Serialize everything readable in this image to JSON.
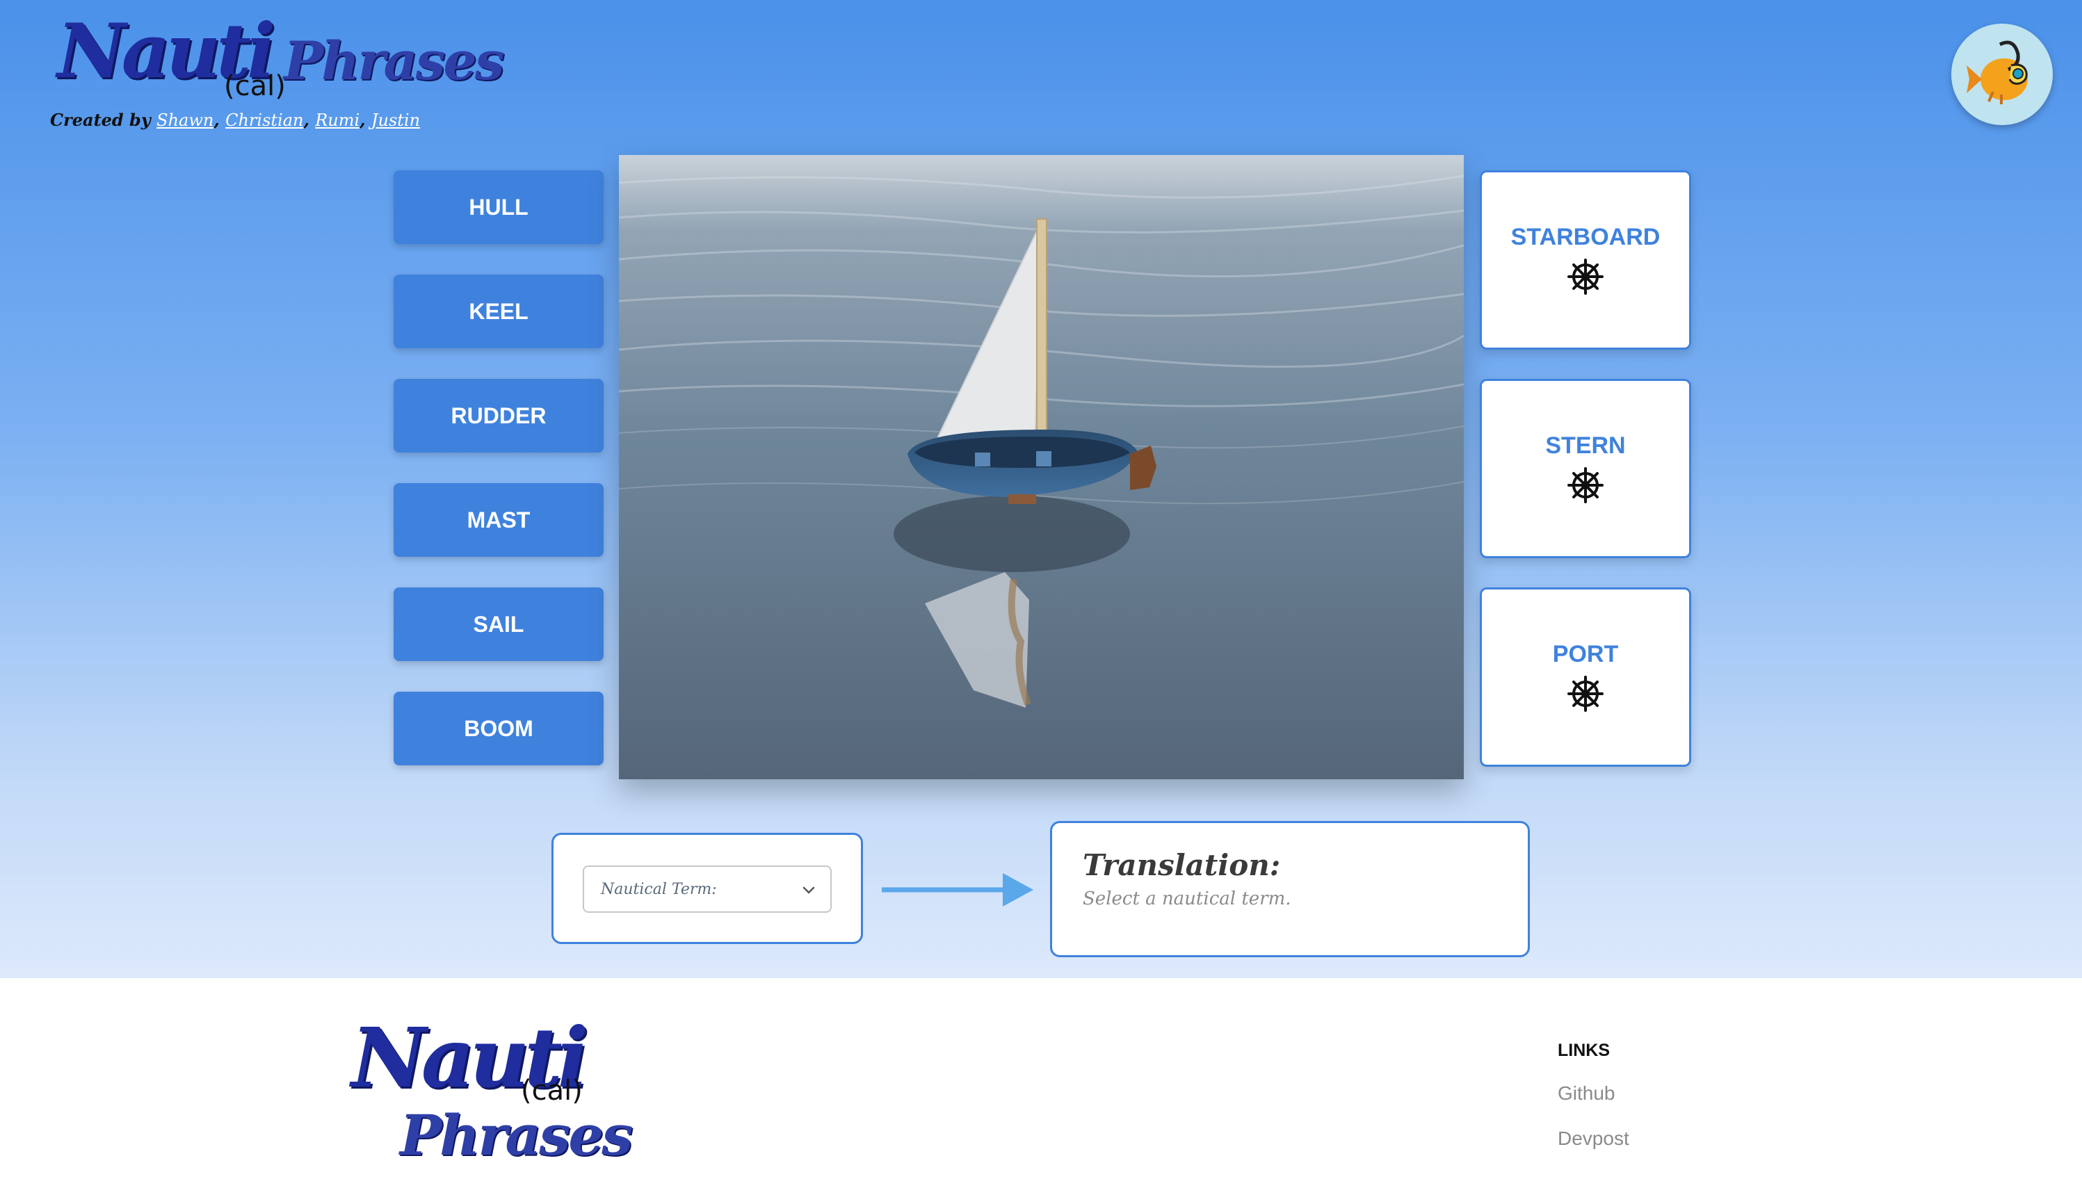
{
  "header": {
    "logo": {
      "part1": "Nauti",
      "part2": "(cal)",
      "part3": "Phrases"
    },
    "credits": {
      "prefix": "Created by",
      "authors": [
        "Shawn",
        "Christian",
        "Rumi",
        "Justin"
      ]
    },
    "avatar_icon": "fish-avatar-icon"
  },
  "parts": [
    {
      "label": "HULL"
    },
    {
      "label": "KEEL"
    },
    {
      "label": "RUDDER"
    },
    {
      "label": "MAST"
    },
    {
      "label": "SAIL"
    },
    {
      "label": "BOOM"
    }
  ],
  "directions": [
    {
      "label": "STARBOARD",
      "icon": "ship-wheel-icon"
    },
    {
      "label": "STERN",
      "icon": "ship-wheel-icon"
    },
    {
      "label": "PORT",
      "icon": "ship-wheel-icon"
    }
  ],
  "term_select": {
    "placeholder": "Nautical Term:"
  },
  "translation": {
    "title": "Translation:",
    "subtitle": "Select a nautical term."
  },
  "footer": {
    "logo": {
      "part1": "Nauti",
      "part2": "(cal)",
      "part3": "Phrases"
    },
    "links_heading": "LINKS",
    "links": [
      {
        "label": "Github"
      },
      {
        "label": "Devpost"
      }
    ]
  },
  "colors": {
    "accent": "#3f82dd",
    "hero_top": "#4a91ea",
    "hero_bottom": "#dde9fb"
  }
}
